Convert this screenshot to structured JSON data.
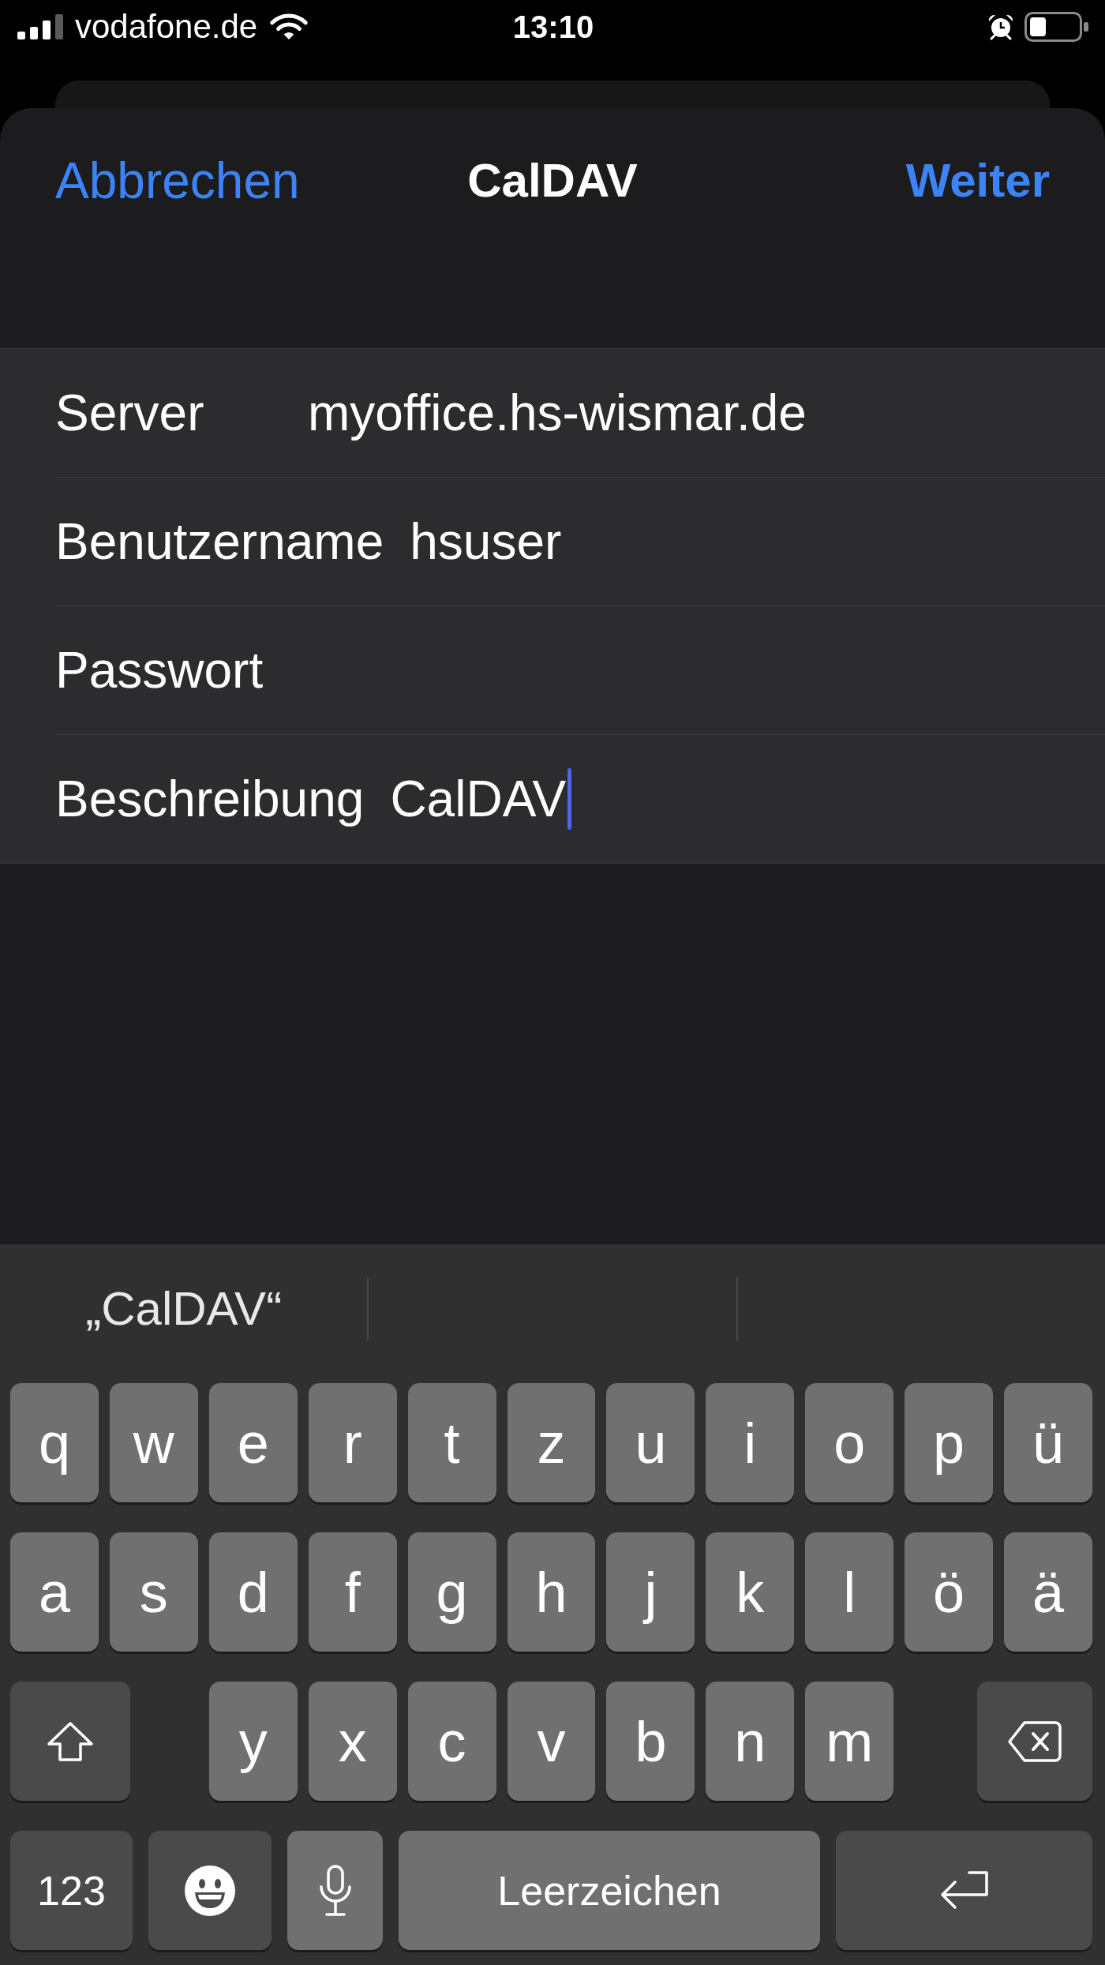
{
  "status_bar": {
    "carrier": "vodafone.de",
    "time": "13:10"
  },
  "nav_bar": {
    "cancel": "Abbrechen",
    "title": "CalDAV",
    "next": "Weiter"
  },
  "fields": [
    {
      "label": "Server",
      "value": "myoffice.hs-wismar.de",
      "focused": false
    },
    {
      "label": "Benutzername",
      "value": "hsuser",
      "focused": false
    },
    {
      "label": "Passwort",
      "focused": false
    },
    {
      "label": "Beschreibung",
      "value": "CalDAV",
      "focused": true
    }
  ],
  "keyboard": {
    "suggestions": [
      "„CalDAV“"
    ],
    "rows": [
      [
        {
          "kind": "letter",
          "label": "q"
        },
        {
          "kind": "letter",
          "label": "w"
        },
        {
          "kind": "letter",
          "label": "e"
        },
        {
          "kind": "letter",
          "label": "r"
        },
        {
          "kind": "letter",
          "label": "t"
        },
        {
          "kind": "letter",
          "label": "z"
        },
        {
          "kind": "letter",
          "label": "u"
        },
        {
          "kind": "letter",
          "label": "i"
        },
        {
          "kind": "letter",
          "label": "o"
        },
        {
          "kind": "letter",
          "label": "p"
        },
        {
          "kind": "letter",
          "label": "ü"
        }
      ],
      [
        {
          "kind": "letter",
          "label": "a"
        },
        {
          "kind": "letter",
          "label": "s"
        },
        {
          "kind": "letter",
          "label": "d"
        },
        {
          "kind": "letter",
          "label": "f"
        },
        {
          "kind": "letter",
          "label": "g"
        },
        {
          "kind": "letter",
          "label": "h"
        },
        {
          "kind": "letter",
          "label": "j"
        },
        {
          "kind": "letter",
          "label": "k"
        },
        {
          "kind": "letter",
          "label": "l"
        },
        {
          "kind": "letter",
          "label": "ö"
        },
        {
          "kind": "letter",
          "label": "ä"
        }
      ],
      [
        {
          "kind": "shift"
        },
        "",
        {
          "kind": "letter",
          "label": "y"
        },
        {
          "kind": "letter",
          "label": "x"
        },
        {
          "kind": "letter",
          "label": "c"
        },
        {
          "kind": "letter",
          "label": "v"
        },
        {
          "kind": "letter",
          "label": "b"
        },
        {
          "kind": "letter",
          "label": "n"
        },
        {
          "kind": "letter",
          "label": "m"
        },
        "",
        {
          "kind": "backspace"
        }
      ]
    ],
    "bottom_row": [
      {
        "kind": "numbers",
        "label": "123"
      },
      {
        "kind": "emoji"
      },
      {
        "kind": "mic"
      },
      {
        "kind": "space",
        "label": "Leerzeichen"
      },
      {
        "kind": "return"
      }
    ]
  }
}
